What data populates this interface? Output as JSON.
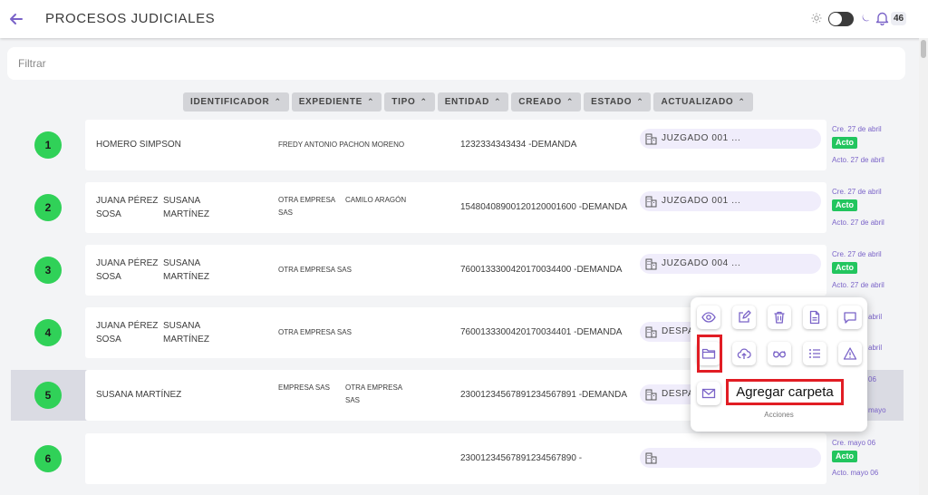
{
  "header": {
    "title": "PROCESOS JUDICIALES",
    "notifications": "46"
  },
  "filter": {
    "placeholder": "Filtrar"
  },
  "columns": [
    "IDENTIFICADOR",
    "EXPEDIENTE",
    "TIPO",
    "ENTIDAD",
    "CREADO",
    "ESTADO",
    "ACTUALIZADO"
  ],
  "rows": [
    {
      "num": "1",
      "p1a": "HOMERO SIMPSON",
      "p1b": "",
      "p2a": "",
      "p2b": "",
      "org1a": "FREDY ANTONIO PACHON MORENO",
      "org1b": "",
      "org2": "",
      "exp": "1232334343434 -DEMANDA",
      "court": "JUZGADO 001 ...",
      "cre": "Cre. 27 de abril",
      "badge": "Acto",
      "act": "Acto. 27 de abril"
    },
    {
      "num": "2",
      "p1a": "JUANA PÉREZ",
      "p1b": "SOSA",
      "p2a": "SUSANA",
      "p2b": "MARTÍNEZ",
      "org1a": "OTRA EMPRESA",
      "org1b": "SAS",
      "org2": "CAMILO ARAGÓN",
      "exp": "154804089001201200016​00 -DEMANDA",
      "court": "JUZGADO 001 ...",
      "cre": "Cre. 27 de abril",
      "badge": "Acto",
      "act": "Acto. 27 de abril"
    },
    {
      "num": "3",
      "p1a": "JUANA PÉREZ",
      "p1b": "SOSA",
      "p2a": "SUSANA",
      "p2b": "MARTÍNEZ",
      "org1a": "OTRA EMPRESA SAS",
      "org1b": "",
      "org2": "",
      "exp": "76001333004201700344​00 -DEMANDA",
      "court": "JUZGADO 004 ...",
      "cre": "Cre. 27 de abril",
      "badge": "Acto",
      "act": "Acto. 27 de abril"
    },
    {
      "num": "4",
      "p1a": "JUANA PÉREZ",
      "p1b": "SOSA",
      "p2a": "SUSANA",
      "p2b": "MARTÍNEZ",
      "org1a": "OTRA EMPRESA SAS",
      "org1b": "",
      "org2": "",
      "exp": "76001333004201700344​01 -DEMANDA",
      "court": "DESPA",
      "cre": "",
      "badge": "",
      "act": ""
    },
    {
      "num": "5",
      "p1a": "SUSANA MARTÍNEZ",
      "p1b": "",
      "p2a": "",
      "p2b": "",
      "org1a": "EMPRESA SAS",
      "org1b": "",
      "org2": "OTRA EMPRESA",
      "org2b": "SAS",
      "exp": "230012345678912345678​91 -DEMANDA",
      "court": "DESPA",
      "cre": "",
      "badge": "",
      "act": ""
    },
    {
      "num": "6",
      "p1a": "",
      "p1b": "",
      "p2a": "",
      "p2b": "",
      "org1a": "",
      "org1b": "",
      "org2": "",
      "exp": "230012345678912345678​90 -",
      "court": "",
      "cre": "Cre. mayo 06",
      "badge": "Acto",
      "act": "Acto. mayo 06"
    }
  ],
  "peek": {
    "r4_top": "abril",
    "r4_bottom": "abril",
    "r5_top": "06",
    "r5_bottom": "mayo"
  },
  "actions": {
    "tooltip": "Agregar carpeta",
    "label": "Acciones",
    "icons": [
      "eye-icon",
      "edit-icon",
      "trash-icon",
      "document-icon",
      "comment-icon",
      "folder-icon",
      "cloud-upload-icon",
      "glasses-icon",
      "list-icon",
      "warning-icon",
      "mail-icon"
    ]
  },
  "colors": {
    "accent": "#7a63c8",
    "badge": "#22c55e",
    "number": "#30d158",
    "highlight": "#e11d24"
  }
}
